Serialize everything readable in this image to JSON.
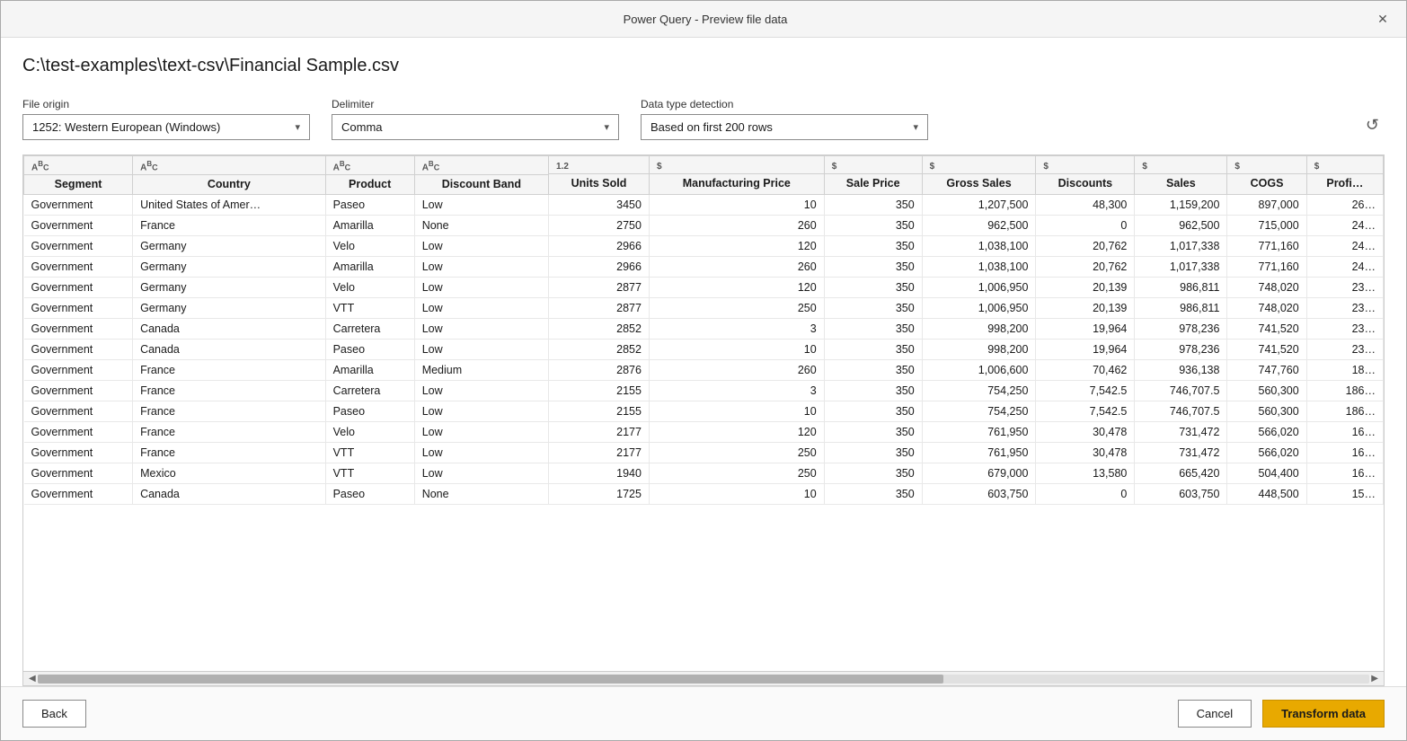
{
  "titleBar": {
    "title": "Power Query - Preview file data",
    "closeLabel": "✕"
  },
  "filePath": "C:\\test-examples\\text-csv\\Financial Sample.csv",
  "controls": {
    "fileOriginLabel": "File origin",
    "fileOriginValue": "1252: Western European (Windows)",
    "delimiterLabel": "Delimiter",
    "delimiterValue": "Comma",
    "dataTypeLabel": "Data type detection",
    "dataTypeValue": "Based on first 200 rows"
  },
  "columns": [
    {
      "name": "Segment",
      "typeIcon": "ABC",
      "typeSub": ""
    },
    {
      "name": "Country",
      "typeIcon": "ABC",
      "typeSub": ""
    },
    {
      "name": "Product",
      "typeIcon": "ABC",
      "typeSub": ""
    },
    {
      "name": "Discount Band",
      "typeIcon": "ABC",
      "typeSub": ""
    },
    {
      "name": "Units Sold",
      "typeIcon": "1.2",
      "typeSub": ""
    },
    {
      "name": "Manufacturing Price",
      "typeIcon": "$",
      "typeSub": ""
    },
    {
      "name": "Sale Price",
      "typeIcon": "$",
      "typeSub": ""
    },
    {
      "name": "Gross Sales",
      "typeIcon": "$",
      "typeSub": ""
    },
    {
      "name": "Discounts",
      "typeIcon": "$",
      "typeSub": ""
    },
    {
      "name": "Sales",
      "typeIcon": "$",
      "typeSub": ""
    },
    {
      "name": "COGS",
      "typeIcon": "$",
      "typeSub": ""
    },
    {
      "name": "Profi…",
      "typeIcon": "$",
      "typeSub": ""
    }
  ],
  "rows": [
    [
      "Government",
      "United States of Amer…",
      "Paseo",
      "Low",
      "3450",
      "10",
      "350",
      "1,207,500",
      "48,300",
      "1,159,200",
      "897,000",
      "26…"
    ],
    [
      "Government",
      "France",
      "Amarilla",
      "None",
      "2750",
      "260",
      "350",
      "962,500",
      "0",
      "962,500",
      "715,000",
      "24…"
    ],
    [
      "Government",
      "Germany",
      "Velo",
      "Low",
      "2966",
      "120",
      "350",
      "1,038,100",
      "20,762",
      "1,017,338",
      "771,160",
      "24…"
    ],
    [
      "Government",
      "Germany",
      "Amarilla",
      "Low",
      "2966",
      "260",
      "350",
      "1,038,100",
      "20,762",
      "1,017,338",
      "771,160",
      "24…"
    ],
    [
      "Government",
      "Germany",
      "Velo",
      "Low",
      "2877",
      "120",
      "350",
      "1,006,950",
      "20,139",
      "986,811",
      "748,020",
      "23…"
    ],
    [
      "Government",
      "Germany",
      "VTT",
      "Low",
      "2877",
      "250",
      "350",
      "1,006,950",
      "20,139",
      "986,811",
      "748,020",
      "23…"
    ],
    [
      "Government",
      "Canada",
      "Carretera",
      "Low",
      "2852",
      "3",
      "350",
      "998,200",
      "19,964",
      "978,236",
      "741,520",
      "23…"
    ],
    [
      "Government",
      "Canada",
      "Paseo",
      "Low",
      "2852",
      "10",
      "350",
      "998,200",
      "19,964",
      "978,236",
      "741,520",
      "23…"
    ],
    [
      "Government",
      "France",
      "Amarilla",
      "Medium",
      "2876",
      "260",
      "350",
      "1,006,600",
      "70,462",
      "936,138",
      "747,760",
      "18…"
    ],
    [
      "Government",
      "France",
      "Carretera",
      "Low",
      "2155",
      "3",
      "350",
      "754,250",
      "7,542.5",
      "746,707.5",
      "560,300",
      "186…"
    ],
    [
      "Government",
      "France",
      "Paseo",
      "Low",
      "2155",
      "10",
      "350",
      "754,250",
      "7,542.5",
      "746,707.5",
      "560,300",
      "186…"
    ],
    [
      "Government",
      "France",
      "Velo",
      "Low",
      "2177",
      "120",
      "350",
      "761,950",
      "30,478",
      "731,472",
      "566,020",
      "16…"
    ],
    [
      "Government",
      "France",
      "VTT",
      "Low",
      "2177",
      "250",
      "350",
      "761,950",
      "30,478",
      "731,472",
      "566,020",
      "16…"
    ],
    [
      "Government",
      "Mexico",
      "VTT",
      "Low",
      "1940",
      "250",
      "350",
      "679,000",
      "13,580",
      "665,420",
      "504,400",
      "16…"
    ],
    [
      "Government",
      "Canada",
      "Paseo",
      "None",
      "1725",
      "10",
      "350",
      "603,750",
      "0",
      "603,750",
      "448,500",
      "15…"
    ]
  ],
  "footer": {
    "backLabel": "Back",
    "cancelLabel": "Cancel",
    "transformLabel": "Transform data"
  }
}
